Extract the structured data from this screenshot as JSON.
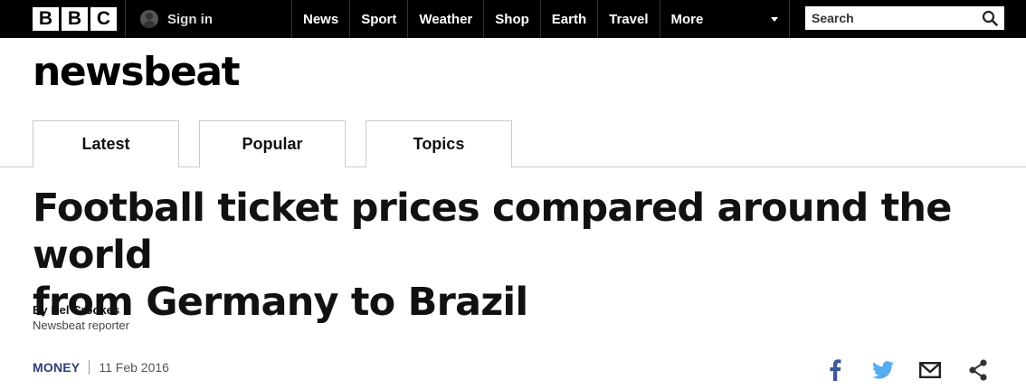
{
  "topbar": {
    "logo_letters": [
      "B",
      "B",
      "C"
    ],
    "signin_label": "Sign in",
    "nav": [
      "News",
      "Sport",
      "Weather",
      "Shop",
      "Earth",
      "Travel"
    ],
    "more_label": "More",
    "search_placeholder": "Search"
  },
  "masthead": "newsbeat",
  "tabs": [
    "Latest",
    "Popular",
    "Topics"
  ],
  "article": {
    "headline_line1": "Football ticket prices compared around the world",
    "headline_line2": "from Germany to Brazil",
    "author": "By Del Crookes",
    "role": "Newsbeat reporter",
    "topic": "MONEY",
    "date": "11 Feb 2016"
  },
  "share_icons": [
    "facebook-icon",
    "twitter-icon",
    "email-icon",
    "share-icon"
  ],
  "colors": {
    "topbar_bg": "#000000",
    "topic": "#2d3f7a",
    "facebook": "#3b5998",
    "twitter": "#55acee"
  }
}
